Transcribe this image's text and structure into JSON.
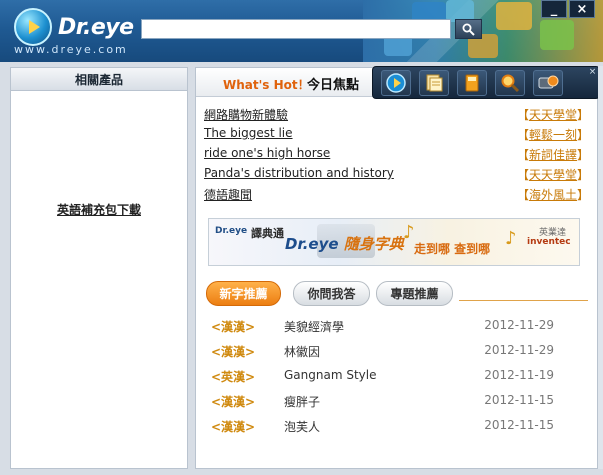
{
  "header": {
    "brand": "Dr.eye",
    "site": "www.dreye.com",
    "search_value": "",
    "window_buttons": [
      "_",
      "×"
    ]
  },
  "left_panel": {
    "title": "相關產品",
    "link": "英語補充包下載"
  },
  "hot_panel": {
    "label": "What's Hot！",
    "title": "今日焦點",
    "items": [
      {
        "text": "網路購物新體驗",
        "category": "天天學堂"
      },
      {
        "text": "The biggest lie",
        "category": "輕鬆一刻"
      },
      {
        "text": "ride one's high horse",
        "category": "新詞佳譯"
      },
      {
        "text": "Panda's distribution and history",
        "category": "天天學堂"
      },
      {
        "text": "德語趣聞",
        "category": "海外風土"
      }
    ]
  },
  "banner": {
    "logo": "Dr.eye",
    "sub": "譯典通",
    "main_left": "Dr.eye",
    "main_right": "隨身字典",
    "tagline": "走到哪 查到哪",
    "vendor_cn": "英業達",
    "vendor_en": "inventec"
  },
  "tabs": {
    "items": [
      "新字推薦",
      "你問我答",
      "專題推薦"
    ],
    "active_index": 0
  },
  "words": [
    {
      "tag": "<漢漢>",
      "word": "美貌經濟學",
      "date": "2012-11-29"
    },
    {
      "tag": "<漢漢>",
      "word": "林徽因",
      "date": "2012-11-29"
    },
    {
      "tag": "<英漢>",
      "word": "Gangnam Style",
      "date": "2012-11-19"
    },
    {
      "tag": "<漢漢>",
      "word": "瘦胖子",
      "date": "2012-11-15"
    },
    {
      "tag": "<漢漢>",
      "word": "泡芙人",
      "date": "2012-11-15"
    }
  ],
  "colors": {
    "accent": "#ec7e12",
    "category": "#c87a08",
    "header_blue": "#1f5a93"
  },
  "icons": {
    "toolbar": [
      "play-icon",
      "note-icon",
      "book-icon",
      "magnifier-icon",
      "dictionary-device-icon"
    ],
    "search": "search-icon"
  }
}
